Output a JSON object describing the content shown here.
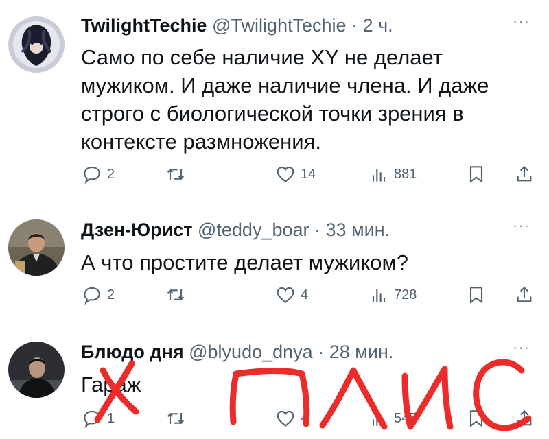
{
  "colors": {
    "text": "#0f1419",
    "secondary": "#536471",
    "annotation": "#ec2b2b"
  },
  "icons": {
    "reply": "speech-bubble-icon",
    "retweet": "retweet-arrows-icon",
    "like": "heart-icon",
    "views": "bar-chart-icon",
    "bookmark": "bookmark-icon",
    "share": "share-upload-icon",
    "more": "more-dots-icon"
  },
  "tweets": [
    {
      "name": "TwilightTechie",
      "handle": "@TwilightTechie",
      "sep": "·",
      "time": "2 ч.",
      "more": "···",
      "lines": [
        "Само по себе наличие XY не делает",
        "мужиком. И даже наличие члена. И даже",
        "строго с биологической точки зрения в",
        "контексте размножения."
      ],
      "replies": "2",
      "retweets": "",
      "likes": "14",
      "views": "881"
    },
    {
      "name": "Дзен-Юрист",
      "handle": "@teddy_boar",
      "sep": "·",
      "time": "33 мин.",
      "more": "···",
      "lines": [
        "А что простите делает мужиком?"
      ],
      "replies": "2",
      "retweets": "",
      "likes": "4",
      "views": "728"
    },
    {
      "name": "Блюдо дня",
      "handle": "@blyudo_dnya",
      "sep": "·",
      "time": "28 мин.",
      "more": "···",
      "lines": [
        "Гараж"
      ],
      "replies": "1",
      "retweets": "",
      "likes": "4",
      "views": "545"
    }
  ],
  "annotation": {
    "handwritten_word": "ПЛИС",
    "cross_mark": "X"
  }
}
